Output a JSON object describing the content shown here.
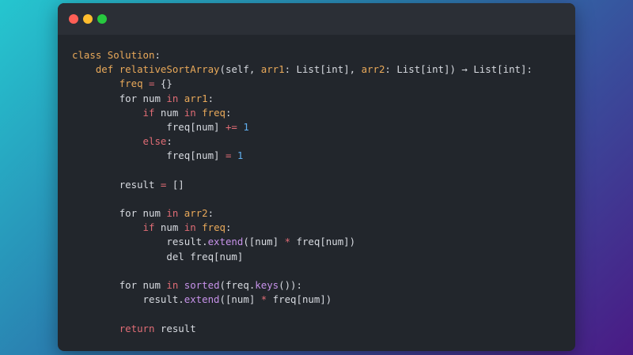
{
  "window": {
    "controls": [
      "close",
      "minimize",
      "maximize"
    ]
  },
  "code_lines": [
    {
      "indent": 0,
      "tokens": [
        {
          "t": "class",
          "c": "kw2"
        },
        {
          "t": " "
        },
        {
          "t": "Solution",
          "c": "name"
        },
        {
          "t": ":"
        }
      ]
    },
    {
      "indent": 1,
      "tokens": [
        {
          "t": "def",
          "c": "kw2"
        },
        {
          "t": " "
        },
        {
          "t": "relativeSortArray",
          "c": "name"
        },
        {
          "t": "(self, "
        },
        {
          "t": "arr1",
          "c": "var"
        },
        {
          "t": ": List[int], "
        },
        {
          "t": "arr2",
          "c": "var"
        },
        {
          "t": ": List[int]) "
        },
        {
          "t": "→",
          "c": "plain"
        },
        {
          "t": " List[int]:"
        }
      ]
    },
    {
      "indent": 2,
      "tokens": [
        {
          "t": "freq",
          "c": "var"
        },
        {
          "t": " "
        },
        {
          "t": "=",
          "c": "op"
        },
        {
          "t": " {}"
        }
      ]
    },
    {
      "indent": 2,
      "tokens": [
        {
          "t": "for num "
        },
        {
          "t": "in",
          "c": "kw"
        },
        {
          "t": " "
        },
        {
          "t": "arr1",
          "c": "var"
        },
        {
          "t": ":"
        }
      ]
    },
    {
      "indent": 3,
      "tokens": [
        {
          "t": "if",
          "c": "kw"
        },
        {
          "t": " num "
        },
        {
          "t": "in",
          "c": "kw"
        },
        {
          "t": " "
        },
        {
          "t": "freq",
          "c": "var"
        },
        {
          "t": ":"
        }
      ]
    },
    {
      "indent": 4,
      "tokens": [
        {
          "t": "freq[num] "
        },
        {
          "t": "+=",
          "c": "op"
        },
        {
          "t": " "
        },
        {
          "t": "1",
          "c": "num"
        }
      ]
    },
    {
      "indent": 3,
      "tokens": [
        {
          "t": "else",
          "c": "kw"
        },
        {
          "t": ":"
        }
      ]
    },
    {
      "indent": 4,
      "tokens": [
        {
          "t": "freq[num] "
        },
        {
          "t": "=",
          "c": "op"
        },
        {
          "t": " "
        },
        {
          "t": "1",
          "c": "num"
        }
      ]
    },
    {
      "indent": 0,
      "tokens": []
    },
    {
      "indent": 2,
      "tokens": [
        {
          "t": "result "
        },
        {
          "t": "=",
          "c": "op"
        },
        {
          "t": " []"
        }
      ]
    },
    {
      "indent": 0,
      "tokens": []
    },
    {
      "indent": 2,
      "tokens": [
        {
          "t": "for num "
        },
        {
          "t": "in",
          "c": "kw"
        },
        {
          "t": " "
        },
        {
          "t": "arr2",
          "c": "var"
        },
        {
          "t": ":"
        }
      ]
    },
    {
      "indent": 3,
      "tokens": [
        {
          "t": "if",
          "c": "kw"
        },
        {
          "t": " num "
        },
        {
          "t": "in",
          "c": "kw"
        },
        {
          "t": " "
        },
        {
          "t": "freq",
          "c": "var"
        },
        {
          "t": ":"
        }
      ]
    },
    {
      "indent": 4,
      "tokens": [
        {
          "t": "result."
        },
        {
          "t": "extend",
          "c": "fn"
        },
        {
          "t": "([num] "
        },
        {
          "t": "*",
          "c": "op"
        },
        {
          "t": " freq[num])"
        }
      ]
    },
    {
      "indent": 4,
      "tokens": [
        {
          "t": "del freq[num]"
        }
      ]
    },
    {
      "indent": 0,
      "tokens": []
    },
    {
      "indent": 2,
      "tokens": [
        {
          "t": "for num "
        },
        {
          "t": "in",
          "c": "kw"
        },
        {
          "t": " "
        },
        {
          "t": "sorted",
          "c": "fn"
        },
        {
          "t": "(freq."
        },
        {
          "t": "keys",
          "c": "fn"
        },
        {
          "t": "()):"
        }
      ]
    },
    {
      "indent": 3,
      "tokens": [
        {
          "t": "result."
        },
        {
          "t": "extend",
          "c": "fn"
        },
        {
          "t": "([num] "
        },
        {
          "t": "*",
          "c": "op"
        },
        {
          "t": " freq[num])"
        }
      ]
    },
    {
      "indent": 0,
      "tokens": []
    },
    {
      "indent": 2,
      "tokens": [
        {
          "t": "return",
          "c": "kw"
        },
        {
          "t": " result"
        }
      ]
    }
  ]
}
